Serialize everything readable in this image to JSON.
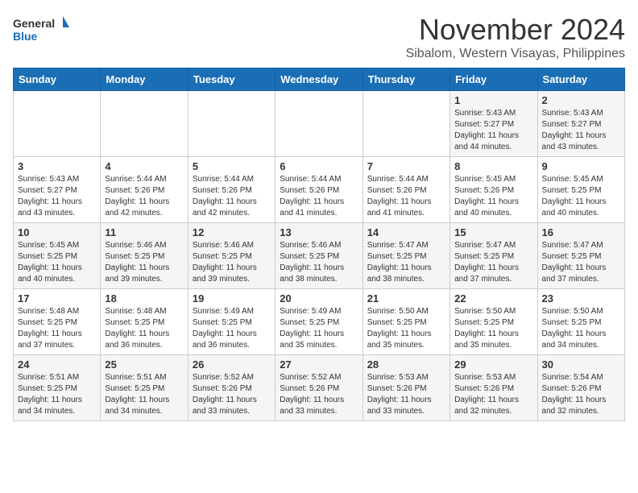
{
  "header": {
    "logo_line1": "General",
    "logo_line2": "Blue",
    "month": "November 2024",
    "location": "Sibalom, Western Visayas, Philippines"
  },
  "weekdays": [
    "Sunday",
    "Monday",
    "Tuesday",
    "Wednesday",
    "Thursday",
    "Friday",
    "Saturday"
  ],
  "weeks": [
    [
      {
        "day": "",
        "info": ""
      },
      {
        "day": "",
        "info": ""
      },
      {
        "day": "",
        "info": ""
      },
      {
        "day": "",
        "info": ""
      },
      {
        "day": "",
        "info": ""
      },
      {
        "day": "1",
        "info": "Sunrise: 5:43 AM\nSunset: 5:27 PM\nDaylight: 11 hours\nand 44 minutes."
      },
      {
        "day": "2",
        "info": "Sunrise: 5:43 AM\nSunset: 5:27 PM\nDaylight: 11 hours\nand 43 minutes."
      }
    ],
    [
      {
        "day": "3",
        "info": "Sunrise: 5:43 AM\nSunset: 5:27 PM\nDaylight: 11 hours\nand 43 minutes."
      },
      {
        "day": "4",
        "info": "Sunrise: 5:44 AM\nSunset: 5:26 PM\nDaylight: 11 hours\nand 42 minutes."
      },
      {
        "day": "5",
        "info": "Sunrise: 5:44 AM\nSunset: 5:26 PM\nDaylight: 11 hours\nand 42 minutes."
      },
      {
        "day": "6",
        "info": "Sunrise: 5:44 AM\nSunset: 5:26 PM\nDaylight: 11 hours\nand 41 minutes."
      },
      {
        "day": "7",
        "info": "Sunrise: 5:44 AM\nSunset: 5:26 PM\nDaylight: 11 hours\nand 41 minutes."
      },
      {
        "day": "8",
        "info": "Sunrise: 5:45 AM\nSunset: 5:26 PM\nDaylight: 11 hours\nand 40 minutes."
      },
      {
        "day": "9",
        "info": "Sunrise: 5:45 AM\nSunset: 5:25 PM\nDaylight: 11 hours\nand 40 minutes."
      }
    ],
    [
      {
        "day": "10",
        "info": "Sunrise: 5:45 AM\nSunset: 5:25 PM\nDaylight: 11 hours\nand 40 minutes."
      },
      {
        "day": "11",
        "info": "Sunrise: 5:46 AM\nSunset: 5:25 PM\nDaylight: 11 hours\nand 39 minutes."
      },
      {
        "day": "12",
        "info": "Sunrise: 5:46 AM\nSunset: 5:25 PM\nDaylight: 11 hours\nand 39 minutes."
      },
      {
        "day": "13",
        "info": "Sunrise: 5:46 AM\nSunset: 5:25 PM\nDaylight: 11 hours\nand 38 minutes."
      },
      {
        "day": "14",
        "info": "Sunrise: 5:47 AM\nSunset: 5:25 PM\nDaylight: 11 hours\nand 38 minutes."
      },
      {
        "day": "15",
        "info": "Sunrise: 5:47 AM\nSunset: 5:25 PM\nDaylight: 11 hours\nand 37 minutes."
      },
      {
        "day": "16",
        "info": "Sunrise: 5:47 AM\nSunset: 5:25 PM\nDaylight: 11 hours\nand 37 minutes."
      }
    ],
    [
      {
        "day": "17",
        "info": "Sunrise: 5:48 AM\nSunset: 5:25 PM\nDaylight: 11 hours\nand 37 minutes."
      },
      {
        "day": "18",
        "info": "Sunrise: 5:48 AM\nSunset: 5:25 PM\nDaylight: 11 hours\nand 36 minutes."
      },
      {
        "day": "19",
        "info": "Sunrise: 5:49 AM\nSunset: 5:25 PM\nDaylight: 11 hours\nand 36 minutes."
      },
      {
        "day": "20",
        "info": "Sunrise: 5:49 AM\nSunset: 5:25 PM\nDaylight: 11 hours\nand 35 minutes."
      },
      {
        "day": "21",
        "info": "Sunrise: 5:50 AM\nSunset: 5:25 PM\nDaylight: 11 hours\nand 35 minutes."
      },
      {
        "day": "22",
        "info": "Sunrise: 5:50 AM\nSunset: 5:25 PM\nDaylight: 11 hours\nand 35 minutes."
      },
      {
        "day": "23",
        "info": "Sunrise: 5:50 AM\nSunset: 5:25 PM\nDaylight: 11 hours\nand 34 minutes."
      }
    ],
    [
      {
        "day": "24",
        "info": "Sunrise: 5:51 AM\nSunset: 5:25 PM\nDaylight: 11 hours\nand 34 minutes."
      },
      {
        "day": "25",
        "info": "Sunrise: 5:51 AM\nSunset: 5:25 PM\nDaylight: 11 hours\nand 34 minutes."
      },
      {
        "day": "26",
        "info": "Sunrise: 5:52 AM\nSunset: 5:26 PM\nDaylight: 11 hours\nand 33 minutes."
      },
      {
        "day": "27",
        "info": "Sunrise: 5:52 AM\nSunset: 5:26 PM\nDaylight: 11 hours\nand 33 minutes."
      },
      {
        "day": "28",
        "info": "Sunrise: 5:53 AM\nSunset: 5:26 PM\nDaylight: 11 hours\nand 33 minutes."
      },
      {
        "day": "29",
        "info": "Sunrise: 5:53 AM\nSunset: 5:26 PM\nDaylight: 11 hours\nand 32 minutes."
      },
      {
        "day": "30",
        "info": "Sunrise: 5:54 AM\nSunset: 5:26 PM\nDaylight: 11 hours\nand 32 minutes."
      }
    ]
  ]
}
